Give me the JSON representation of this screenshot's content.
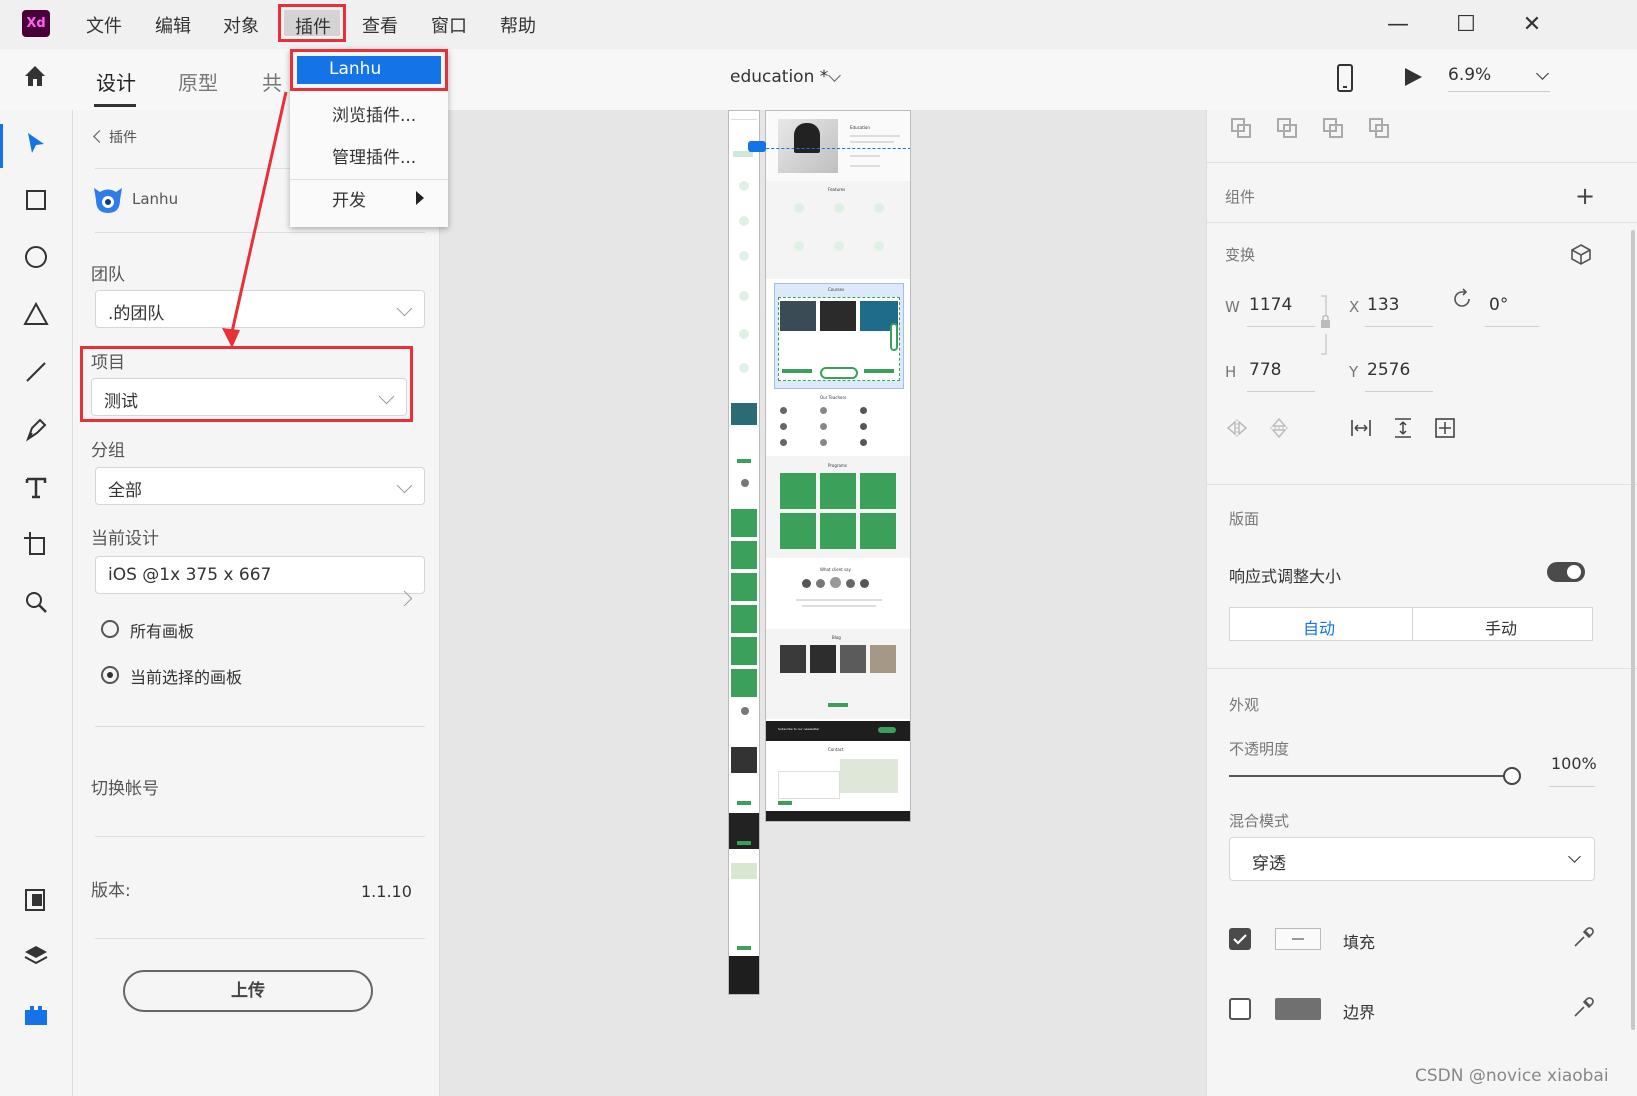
{
  "app": {
    "logo": "Xd",
    "logo_color": "#470137",
    "logo_text_color": "#ff61f6"
  },
  "menubar": {
    "items": [
      "文件",
      "编辑",
      "对象",
      "插件",
      "查看",
      "窗口",
      "帮助"
    ],
    "active": "插件"
  },
  "window_controls": {
    "minimize": "—",
    "maximize": "☐",
    "close": "✕"
  },
  "modebar": {
    "home_icon": "home-icon",
    "tabs": [
      "设计",
      "原型",
      "共"
    ],
    "active_tab": "设计",
    "document_title": "education *",
    "zoom": "6.9%"
  },
  "plugin_menu": {
    "items": [
      {
        "label": "Lanhu",
        "selected": true
      },
      {
        "label": "浏览插件..."
      },
      {
        "label": "管理插件..."
      },
      {
        "label": "开发",
        "submenu": true
      }
    ]
  },
  "plugin_panel": {
    "back_label": "插件",
    "plugin_name": "Lanhu",
    "team_label": "团队",
    "team_value": ".的团队",
    "project_label": "项目",
    "project_value": "测试",
    "group_label": "分组",
    "group_value": "全部",
    "current_design_label": "当前设计",
    "current_design_value": "iOS @1x 375 x 667",
    "radio_all": "所有画板",
    "radio_selected": "当前选择的画板",
    "radio_selected_value": "当前选择的画板",
    "switch_account": "切换帐号",
    "version_label": "版本:",
    "version_value": "1.1.10",
    "upload_button": "上传"
  },
  "canvas": {
    "artboard_title": "Education",
    "sections": [
      "Features",
      "Courses",
      "Our Teachers",
      "Programs",
      "What client say",
      "Blog",
      "Subscribe to our newsletter",
      "Contact"
    ]
  },
  "properties": {
    "component_label": "组件",
    "transform_label": "变换",
    "w_label": "W",
    "w_value": "1174",
    "x_label": "X",
    "x_value": "133",
    "h_label": "H",
    "h_value": "778",
    "y_label": "Y",
    "y_value": "2576",
    "rotation_value": "0°",
    "layout_label": "版面",
    "responsive_label": "响应式调整大小",
    "responsive_on": true,
    "auto_label": "自动",
    "manual_label": "手动",
    "appearance_label": "外观",
    "opacity_label": "不透明度",
    "opacity_value": "100%",
    "blend_label": "混合模式",
    "blend_value": "穿透",
    "fill_label": "填充",
    "fill_checked": true,
    "border_label": "边界",
    "border_checked": false
  },
  "watermark": "CSDN @novice xiaobai",
  "colors": {
    "accent_blue": "#1473e6",
    "annotation_red": "#e8303a",
    "green": "#3aa05a"
  }
}
